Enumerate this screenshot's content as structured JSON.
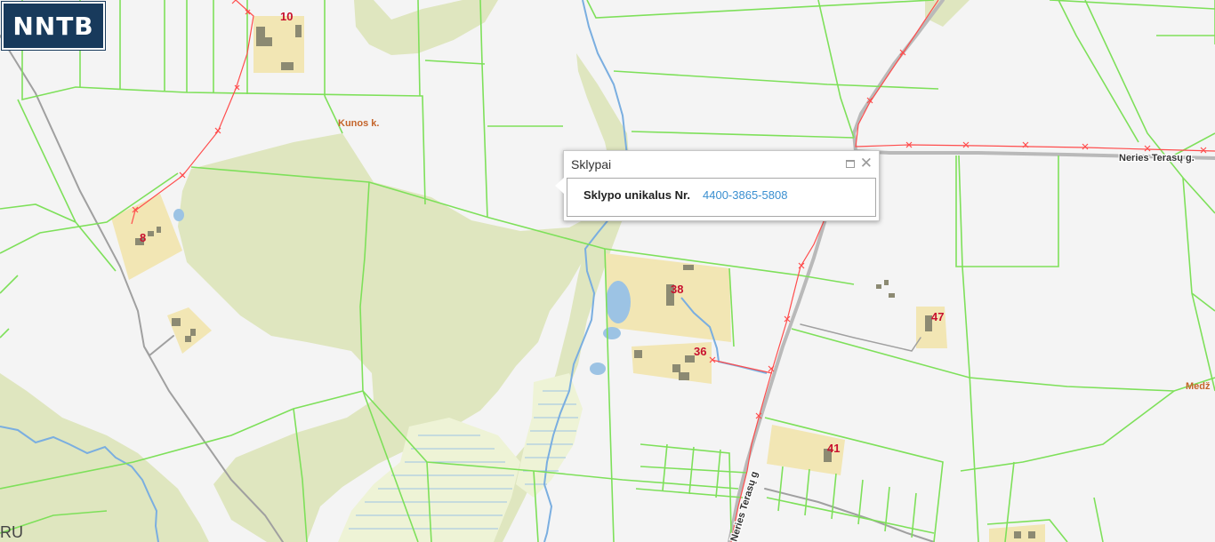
{
  "brand": {
    "logo_text": "NNTB"
  },
  "popup": {
    "title": "Sklypai",
    "field_label": "Sklypo unikalus Nr.",
    "field_value": "4400-3865-5808"
  },
  "map": {
    "place_labels": [
      "Kunos k.",
      "Medž"
    ],
    "street_labels": [
      "Neries Terasų g.",
      "Neries Terasų g"
    ],
    "edge_label": "RU",
    "house_numbers": [
      "10",
      "8",
      "38",
      "36",
      "47",
      "41"
    ],
    "colors": {
      "background": "#f4f4f4",
      "forest": "#dfe6bf",
      "wetland": "#eef3d6",
      "parcel_line": "#7ee05a",
      "building_area": "#f2e6b4",
      "building": "#8c8a72",
      "water": "#9cc3e4",
      "power_line": "#ff4d4d",
      "road": "#a0a0a0",
      "house_number": "#c8102e",
      "place_label": "#c4642a",
      "link": "#3a8fd0",
      "logo_bg": "#183a5c"
    }
  }
}
